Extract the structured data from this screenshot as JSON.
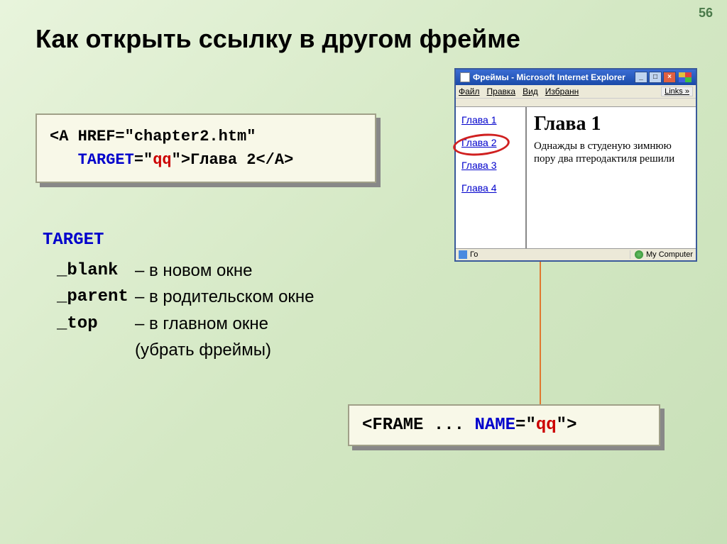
{
  "page_number": "56",
  "title": "Как открыть ссылку в другом фрейме",
  "code1": {
    "line1_a": "<A HREF=\"chapter2.htm\"",
    "line2_label": "TARGET",
    "line2_eq": "=\"",
    "line2_val": "qq",
    "line2_rest": "\">Глава 2</A>"
  },
  "target_header": "TARGET",
  "targets": [
    {
      "key": "_blank",
      "desc": "– в новом окне"
    },
    {
      "key": "_parent",
      "desc": "– в родительском окне"
    },
    {
      "key": "_top",
      "desc": "– в главном окне"
    },
    {
      "key": "",
      "desc": "(убрать фреймы)"
    }
  ],
  "code2": {
    "p1": "<FRAME ... ",
    "name_kw": "NAME",
    "eq": "=\"",
    "val": "qq",
    "rest": "\">"
  },
  "browser": {
    "title": "Фреймы - Microsoft Internet Explorer",
    "menu": [
      "Файл",
      "Правка",
      "Вид",
      "Избранн"
    ],
    "links_label": "Links",
    "chapters": [
      "Глава 1",
      "Глава 2",
      "Глава 3",
      "Глава 4"
    ],
    "content_title": "Глава 1",
    "content_body": "Однажды в студеную зимнюю пору два птеродактиля решили",
    "status_left": "Го",
    "status_right": "My Computer"
  }
}
